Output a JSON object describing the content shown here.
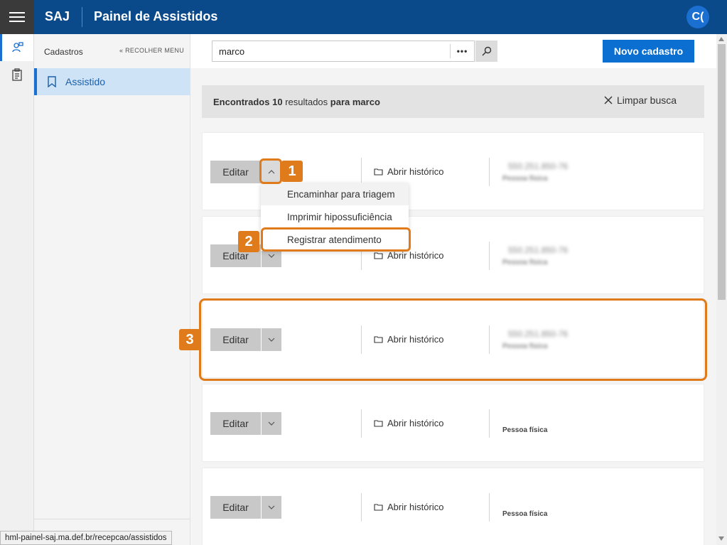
{
  "header": {
    "brand": "SAJ",
    "title": "Painel de Assistidos",
    "avatar_initials": "C("
  },
  "sidebar": {
    "title": "Cadastros",
    "collapse_label": "RECOLHER MENU",
    "items": [
      {
        "label": "Assistido",
        "icon": "bookmark-book-icon",
        "active": true
      }
    ],
    "rail_icons": [
      "user-search-icon",
      "clipboard-icon"
    ]
  },
  "search": {
    "value": "marco",
    "more_label": "•••",
    "new_button_label": "Novo cadastro"
  },
  "results": {
    "prefix": "Encontrados",
    "count": "10",
    "middle": "resultados",
    "for_label": "para marco",
    "clear_label": "Limpar busca"
  },
  "cards": [
    {
      "edit_label": "Editar",
      "history_label": "Abrir histórico",
      "cpf": "550.251.850-76",
      "person_type": "Pessoa física",
      "obscured": true
    },
    {
      "edit_label": "Editar",
      "history_label": "Abrir histórico",
      "cpf": "550.251.850-76",
      "person_type": "Pessoa física",
      "obscured": true
    },
    {
      "edit_label": "Editar",
      "history_label": "Abrir histórico",
      "cpf": "550.251.850-76",
      "person_type": "Pessoa física",
      "obscured": true
    },
    {
      "edit_label": "Editar",
      "history_label": "Abrir histórico",
      "cpf": "",
      "person_type": "Pessoa física",
      "obscured": false
    },
    {
      "edit_label": "Editar",
      "history_label": "Abrir histórico",
      "cpf": "",
      "person_type": "Pessoa física",
      "obscured": false
    }
  ],
  "dropdown": {
    "items": [
      "Encaminhar para triagem",
      "Imprimir hipossuficiência",
      "Registrar atendimento"
    ]
  },
  "annotations": {
    "step1": "1",
    "step2": "2",
    "step3": "3",
    "color": "#e07b1c"
  },
  "status_url": "hml-painel-saj.ma.def.br/recepcao/assistidos",
  "colors": {
    "topbar": "#0a4a8a",
    "primary": "#0a6fd1",
    "active_menu_bg": "#cfe3f7"
  }
}
